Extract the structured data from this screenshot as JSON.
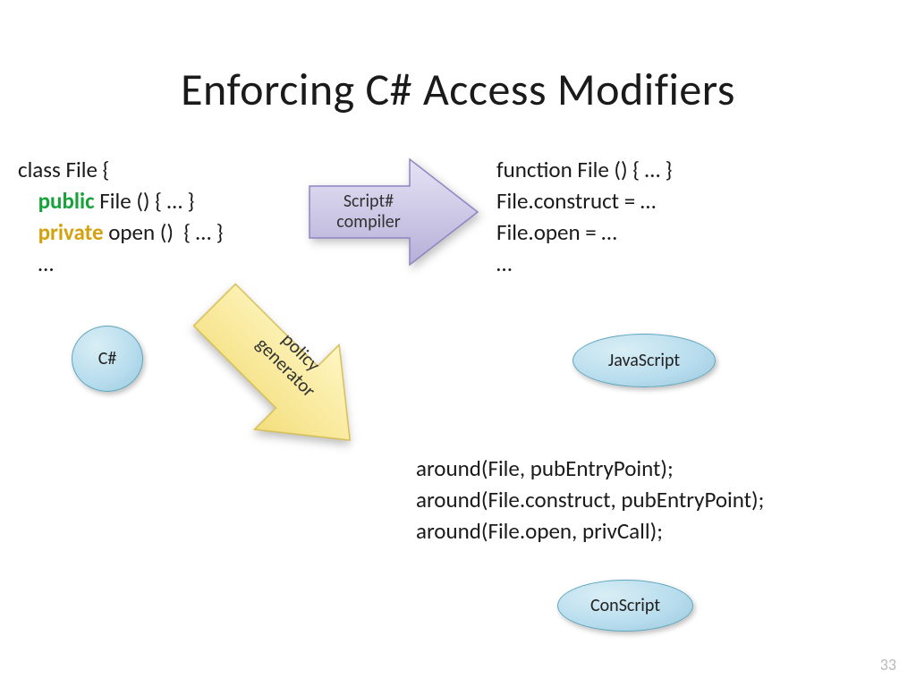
{
  "title": "Enforcing C# Access Modifiers",
  "page_number": "33",
  "csharp": {
    "line1": "class File {",
    "kw_public": "public",
    "line2_rest": " File () { … }",
    "kw_private": "private",
    "line3_rest": " open ()  { … }",
    "line4": "    …"
  },
  "js": {
    "line1": "function File () { … }",
    "line2": "File.construct = …",
    "line3": "File.open = …",
    "line4": "…"
  },
  "conscript": {
    "line1": "around(File, pubEntryPoint);",
    "line2": "around(File.construct, pubEntryPoint);",
    "line3": "around(File.open, privCall);"
  },
  "bubbles": {
    "csharp": "C#",
    "js": "JavaScript",
    "conscript": "ConScript"
  },
  "arrows": {
    "compiler_line1": "Script#",
    "compiler_line2": "compiler",
    "policy_line1": "policy",
    "policy_line2": "generator"
  },
  "colors": {
    "arrow_compiler_fill1": "#e6e3f5",
    "arrow_compiler_fill2": "#b6afd8",
    "arrow_compiler_stroke": "#8e85c3",
    "arrow_policy_fill1": "#fff7c4",
    "arrow_policy_fill2": "#f3de7d",
    "arrow_policy_stroke": "#d6bf55"
  }
}
